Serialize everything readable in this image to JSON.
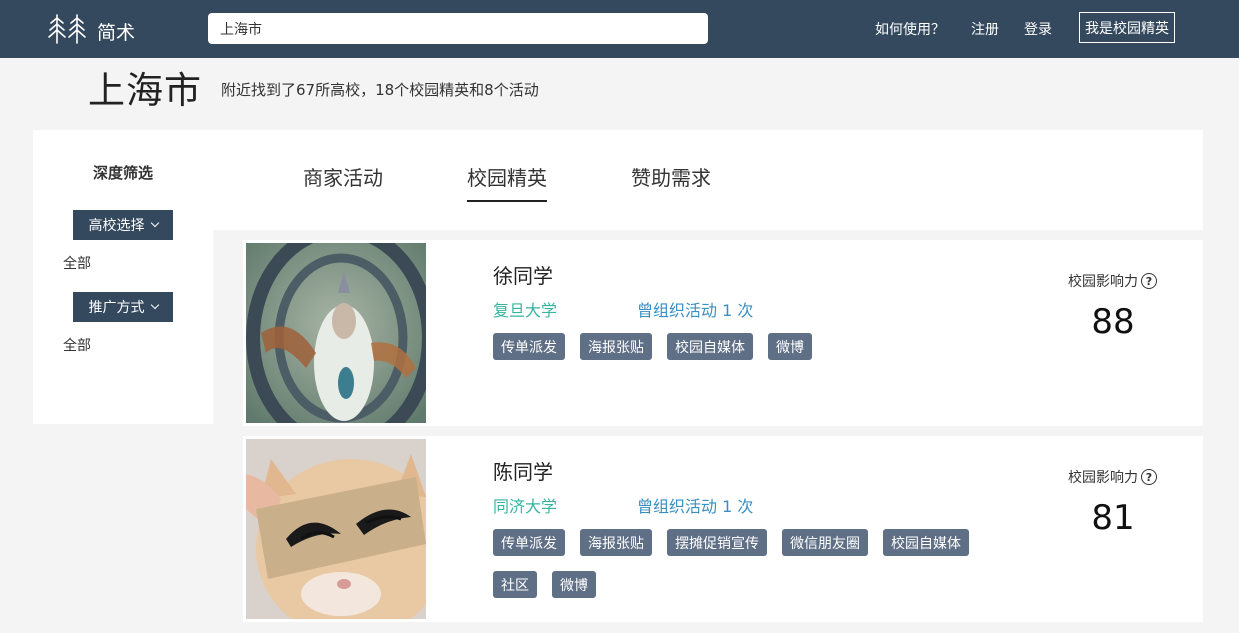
{
  "brand": {
    "name": "简术",
    "logo_icon": "trees-logo-icon"
  },
  "search": {
    "value": "上海市"
  },
  "nav": {
    "how_to_use": "如何使用？",
    "register": "注册",
    "login": "登录",
    "elite_button": "我是校园精英"
  },
  "header": {
    "city": "上海市",
    "summary": "附近找到了67所高校，18个校园精英和8个活动"
  },
  "sidebar": {
    "title": "深度筛选",
    "filters": [
      {
        "label": "高校选择",
        "value": "全部"
      },
      {
        "label": "推广方式",
        "value": "全部"
      }
    ]
  },
  "tabs": [
    {
      "label": "商家活动",
      "active": false
    },
    {
      "label": "校园精英",
      "active": true
    },
    {
      "label": "赞助需求",
      "active": false
    }
  ],
  "influence_label": "校园影响力",
  "colors": {
    "nav_bg": "#34495e",
    "school": "#35b5a0",
    "events": "#3a8fc2",
    "tag_bg": "#5f6f86"
  },
  "people": [
    {
      "name": "徐同学",
      "school": "复旦大学",
      "events": "曾组织活动 1 次",
      "tags": [
        "传单派发",
        "海报张贴",
        "校园自媒体",
        "微博"
      ],
      "score": "88"
    },
    {
      "name": "陈同学",
      "school": "同济大学",
      "events": "曾组织活动 1 次",
      "tags": [
        "传单派发",
        "海报张贴",
        "摆摊促销宣传",
        "微信朋友圈",
        "校园自媒体",
        "社区",
        "微博"
      ],
      "score": "81"
    }
  ]
}
